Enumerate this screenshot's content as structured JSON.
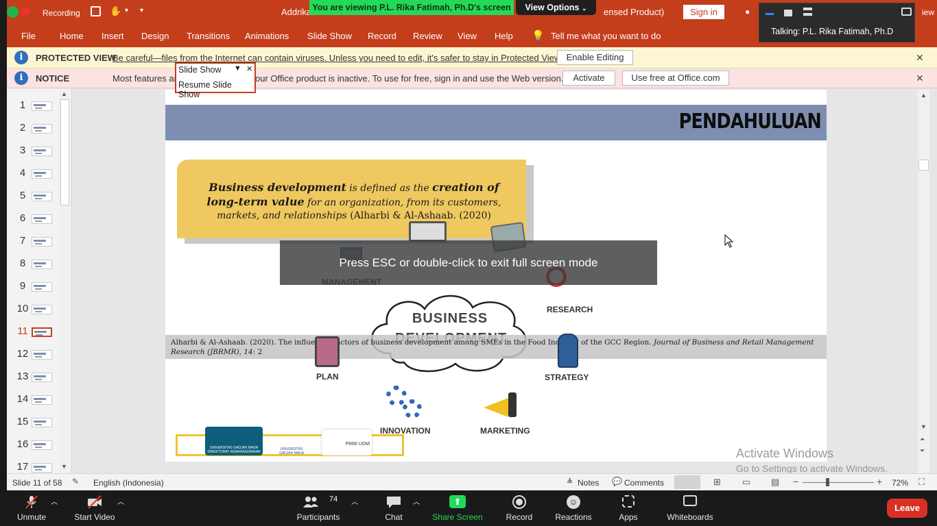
{
  "zoom_top": {
    "recording_label": "Recording",
    "viewing_banner": "You are viewing P.L. Rika Fatimah, Ph.D's screen",
    "view_options_label": "View Options",
    "talking_label": "Talking: P.L. Rika Fatimah, Ph.D"
  },
  "ppt": {
    "title_left": "Addrika",
    "title_right": "ensed Product)",
    "sign_in_label": "Sign in",
    "right_partial": "iew",
    "menu": [
      "File",
      "Home",
      "Insert",
      "Design",
      "Transitions",
      "Animations",
      "Slide Show",
      "Record",
      "Review",
      "View",
      "Help"
    ],
    "tell_me": "Tell me what you want to do",
    "protected_title": "PROTECTED VIEW",
    "protected_msg": "Be careful—files from the Internet can contain viruses. Unless you need to edit, it's safer to stay in Protected View.",
    "enable_editing_label": "Enable Editing",
    "notice_title": "NOTICE",
    "notice_msg_a": "Most features ar",
    "notice_msg_b": "our Office product is inactive. To use for free, sign in and use the Web version.",
    "activate_label": "Activate",
    "use_free_label": "Use free at Office.com",
    "slideshow_popup_title": "Slide Show",
    "slideshow_popup_resume": "Resume Slide Show",
    "thumbnails": [
      "1",
      "2",
      "3",
      "4",
      "5",
      "6",
      "7",
      "8",
      "9",
      "10",
      "11",
      "12",
      "13",
      "14",
      "15",
      "16",
      "17"
    ],
    "selected_thumbnail": "11"
  },
  "slide": {
    "title": "PENDAHULUAN",
    "def_term": "Business development",
    "def_mid": " is defined as the ",
    "def_term2": "creation of long-term value",
    "def_rest": " for an organization, from its customers, markets, and relationships",
    "def_citation": " (Alharbi & Al-Ashaab. (2020)",
    "cloud_label_1": "BUSINESS",
    "cloud_label_2": "DEVELOPMENT",
    "nodes": [
      "MANAGEMENT",
      "RESEARCH",
      "PLAN",
      "STRATEGY",
      "INNOVATION",
      "MARKETING"
    ],
    "reference_plain": "Alharbi & Al-Ashaab. (2020). The influential factors of business development among SMEs in the Food Industry of the GCC Region. ",
    "reference_italic": "Journal of Business and Retail Management Research (JBRMR), 14",
    "reference_end": ": 2",
    "logo_1": "UNIVERSITAS GADJAH MADA DIREKTORAT KEMAHASISWAAN",
    "logo_2": "UNIVERSITAS GADJAH MADA",
    "logo_3": "PMW UGM"
  },
  "overlay": {
    "esc_message": "Press ESC or double-click to exit full screen mode",
    "activate_windows_title": "Activate Windows",
    "activate_windows_sub": "Go to Settings to activate Windows."
  },
  "status": {
    "slide_info": "Slide 11 of 58",
    "language": "English (Indonesia)",
    "notes_label": "Notes",
    "comments_label": "Comments",
    "zoom_level": "72%"
  },
  "zoom_bottom": {
    "unmute": "Unmute",
    "start_video": "Start Video",
    "participants": "Participants",
    "participant_count": "74",
    "chat": "Chat",
    "share_screen": "Share Screen",
    "record": "Record",
    "reactions": "Reactions",
    "apps": "Apps",
    "whiteboards": "Whiteboards",
    "leave": "Leave"
  },
  "colors": {
    "ppt_accent": "#c43e1c",
    "share_green": "#23d959",
    "leave_red": "#d93025",
    "slide_header": "#7d8eb0",
    "def_box": "#efc85f"
  }
}
